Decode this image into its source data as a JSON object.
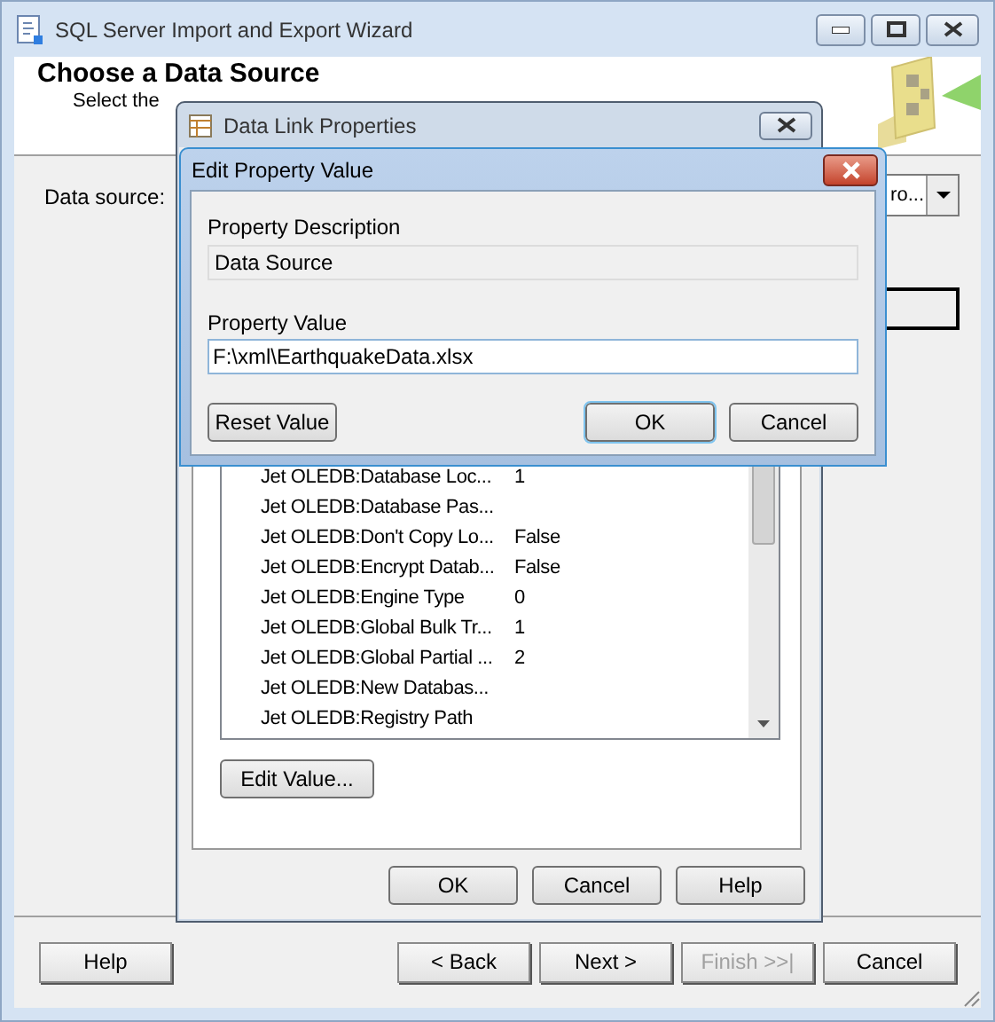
{
  "wizard": {
    "title": "SQL Server Import and Export Wizard",
    "header": {
      "title": "Choose a Data Source",
      "subtitle": "Select the"
    },
    "data_source": {
      "label": "Data source:",
      "value": "ro..."
    },
    "buttons": [
      {
        "label": "Help",
        "disabled": false
      },
      {
        "label": "< Back",
        "disabled": false
      },
      {
        "label": "Next >",
        "disabled": false
      },
      {
        "label": "Finish >>|",
        "disabled": true
      },
      {
        "label": "Cancel",
        "disabled": false
      }
    ]
  },
  "data_link": {
    "title": "Data Link Properties",
    "properties": [
      {
        "name": "Jet OLEDB:Database Loc...",
        "value": "1"
      },
      {
        "name": "Jet OLEDB:Database Pas..."
      },
      {
        "name": "Jet OLEDB:Don't Copy Lo...",
        "value": "False"
      },
      {
        "name": "Jet OLEDB:Encrypt Datab...",
        "value": "False"
      },
      {
        "name": "Jet OLEDB:Engine Type",
        "value": "0"
      },
      {
        "name": "Jet OLEDB:Global Bulk Tr...",
        "value": "1"
      },
      {
        "name": "Jet OLEDB:Global Partial ...",
        "value": "2"
      },
      {
        "name": "Jet OLEDB:New Databas..."
      },
      {
        "name": "Jet OLEDB:Registry Path"
      }
    ],
    "edit_button": "Edit Value...",
    "buttons": [
      "OK",
      "Cancel",
      "Help"
    ]
  },
  "edit_dialog": {
    "title": "Edit Property Value",
    "description_label": "Property Description",
    "description": "Data Source",
    "value_label": "Property Value",
    "value": "F:\\xml\\EarthquakeData.xlsx",
    "buttons": [
      {
        "label": "Reset Value",
        "default": false
      },
      {
        "label": "OK",
        "default": true
      },
      {
        "label": "Cancel",
        "default": false
      }
    ]
  }
}
